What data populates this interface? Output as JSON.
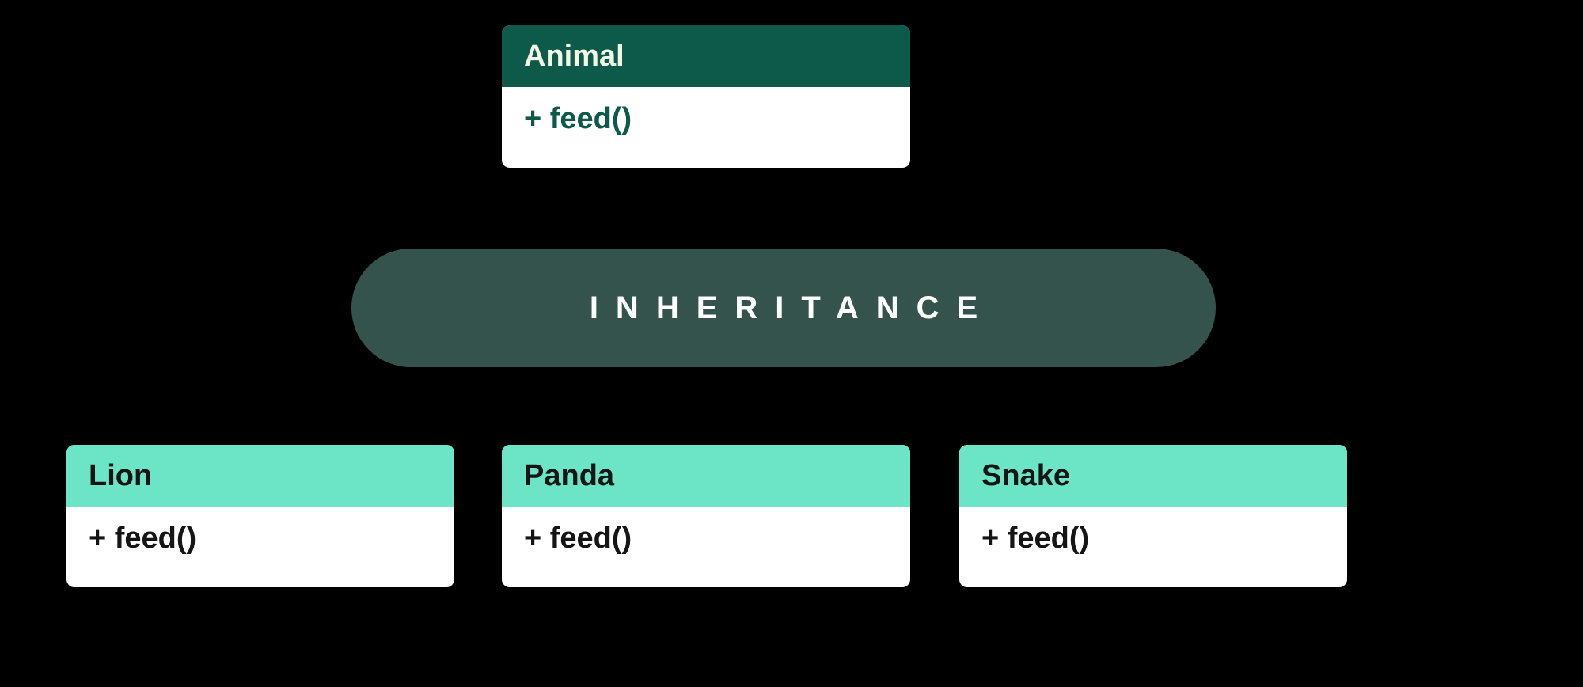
{
  "relationship_label": "INHERITANCE",
  "parent": {
    "name": "Animal",
    "method": "+ feed()"
  },
  "children": [
    {
      "name": "Lion",
      "method": "+ feed()"
    },
    {
      "name": "Panda",
      "method": "+ feed()"
    },
    {
      "name": "Snake",
      "method": "+ feed()"
    }
  ],
  "colors": {
    "parent_header_bg": "#0d5a4a",
    "parent_header_fg": "#f2f7e7",
    "child_header_bg": "#6be5c6",
    "child_header_fg": "#151515",
    "pill_bg": "#35534d",
    "pill_fg": "#ffffff",
    "body_bg": "#ffffff"
  }
}
